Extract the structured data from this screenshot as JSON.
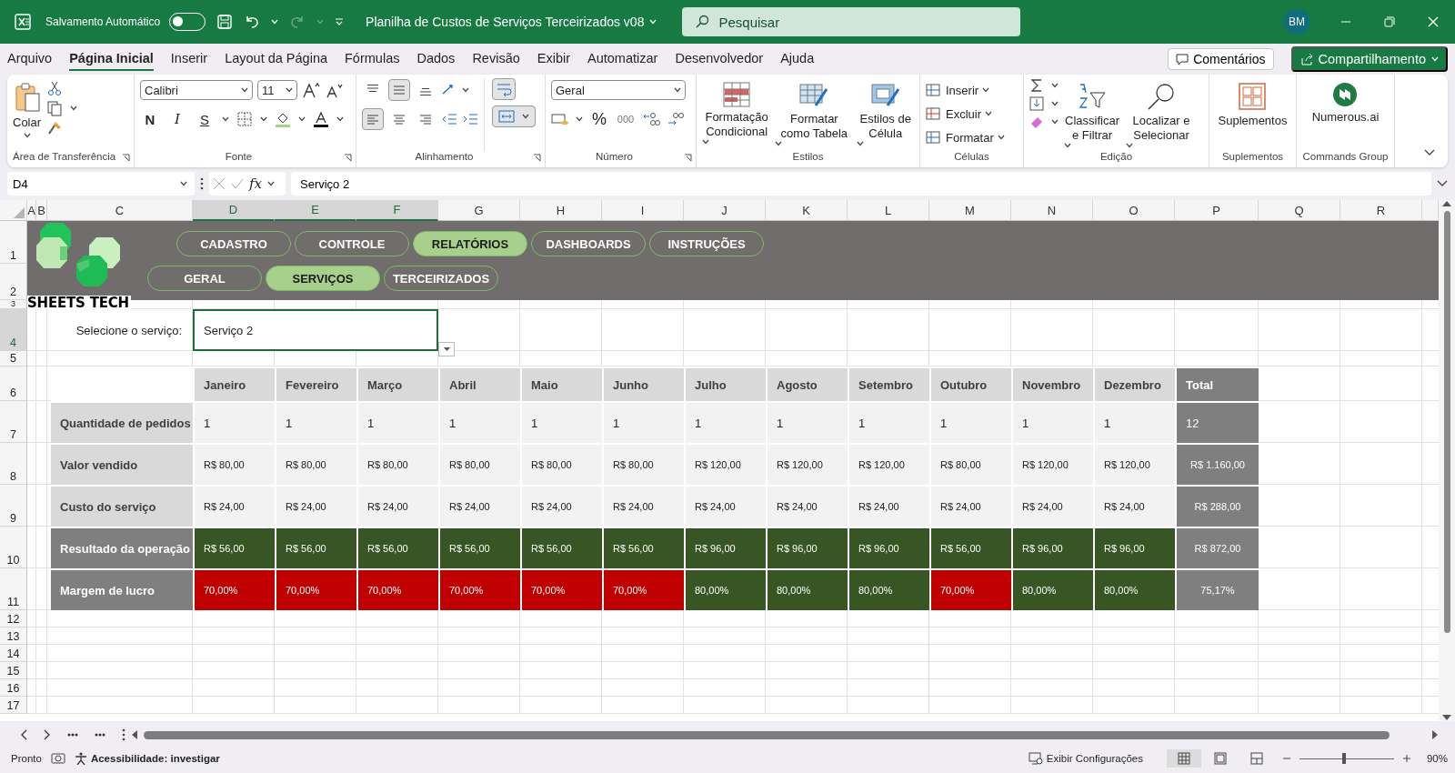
{
  "title_bar": {
    "autosave": {
      "label": "Salvamento Automático",
      "on": false
    },
    "document_title": "Planilha de Custos de Serviços Terceirizados v08",
    "search": {
      "placeholder": "Pesquisar"
    },
    "user_initials": "BM"
  },
  "menu_tabs": [
    {
      "label": "Arquivo",
      "selected": false
    },
    {
      "label": "Página Inicial",
      "selected": true
    },
    {
      "label": "Inserir",
      "selected": false
    },
    {
      "label": "Layout da Página",
      "selected": false
    },
    {
      "label": "Fórmulas",
      "selected": false
    },
    {
      "label": "Dados",
      "selected": false
    },
    {
      "label": "Revisão",
      "selected": false
    },
    {
      "label": "Exibir",
      "selected": false
    },
    {
      "label": "Automatizar",
      "selected": false
    },
    {
      "label": "Desenvolvedor",
      "selected": false
    },
    {
      "label": "Ajuda",
      "selected": false
    }
  ],
  "comments_button": "Comentários",
  "share_button": "Compartilhamento",
  "ribbon": {
    "clipboard": {
      "paste": "Colar",
      "label": "Área de Transferência"
    },
    "font": {
      "family": "Calibri",
      "size": "11",
      "bold": "N",
      "italic": "I",
      "underline": "S",
      "label": "Fonte"
    },
    "alignment": {
      "vertical": [
        {
          "selected": false
        },
        {
          "selected": true
        },
        {
          "selected": false
        }
      ],
      "horizontal": [
        {
          "selected": true
        },
        {
          "selected": false
        },
        {
          "selected": false
        }
      ],
      "label": "Alinhamento"
    },
    "number": {
      "format": "Geral",
      "percent": "%",
      "thousands": "000",
      "label": "Número"
    },
    "styles": {
      "buttons": [
        "Formatação Condicional",
        "Formatar como Tabela",
        "Estilos de Célula"
      ],
      "label": "Estilos"
    },
    "cells": {
      "buttons": [
        "Inserir",
        "Excluir",
        "Formatar"
      ],
      "label": "Células"
    },
    "editing": {
      "buttons": [
        "Classificar e Filtrar",
        "Localizar e Selecionar"
      ],
      "label": "Edição"
    },
    "addins": {
      "button": "Suplementos",
      "label": "Suplementos"
    },
    "commands": {
      "button": "Numerous.ai",
      "label": "Commands Group"
    }
  },
  "formula_bar": {
    "name_box": "D4",
    "fx": "fx",
    "value": "Serviço 2"
  },
  "columns": [
    {
      "label": "A",
      "selected": false
    },
    {
      "label": "B",
      "selected": false
    },
    {
      "label": "C",
      "selected": false
    },
    {
      "label": "D",
      "selected": true
    },
    {
      "label": "E",
      "selected": true
    },
    {
      "label": "F",
      "selected": true
    },
    {
      "label": "G",
      "selected": false
    },
    {
      "label": "H",
      "selected": false
    },
    {
      "label": "I",
      "selected": false
    },
    {
      "label": "J",
      "selected": false
    },
    {
      "label": "K",
      "selected": false
    },
    {
      "label": "L",
      "selected": false
    },
    {
      "label": "M",
      "selected": false
    },
    {
      "label": "N",
      "selected": false
    },
    {
      "label": "O",
      "selected": false
    },
    {
      "label": "P",
      "selected": false
    },
    {
      "label": "Q",
      "selected": false
    },
    {
      "label": "R",
      "selected": false
    }
  ],
  "rows": [
    {
      "label": "1",
      "selected": false
    },
    {
      "label": "2",
      "selected": false
    },
    {
      "label": "3",
      "selected": false
    },
    {
      "label": "4",
      "selected": true
    },
    {
      "label": "5",
      "selected": false
    },
    {
      "label": "6",
      "selected": false
    },
    {
      "label": "7",
      "selected": false
    },
    {
      "label": "8",
      "selected": false
    },
    {
      "label": "9",
      "selected": false
    },
    {
      "label": "10",
      "selected": false
    },
    {
      "label": "11",
      "selected": false
    },
    {
      "label": "12",
      "selected": false
    },
    {
      "label": "13",
      "selected": false
    },
    {
      "label": "14",
      "selected": false
    },
    {
      "label": "15",
      "selected": false
    },
    {
      "label": "16",
      "selected": false
    },
    {
      "label": "17",
      "selected": false
    }
  ],
  "sheet": {
    "logo_text": "SHEETS TECH",
    "nav_main": [
      {
        "label": "CADASTRO",
        "selected": false
      },
      {
        "label": "CONTROLE",
        "selected": false
      },
      {
        "label": "RELATÓRIOS",
        "selected": true
      },
      {
        "label": "DASHBOARDS",
        "selected": false
      },
      {
        "label": "INSTRUÇÕES",
        "selected": false
      }
    ],
    "nav_sub": [
      {
        "label": "GERAL",
        "selected": false
      },
      {
        "label": "SERVIÇOS",
        "selected": true
      },
      {
        "label": "TERCEIRIZADOS",
        "selected": false
      }
    ],
    "selector": {
      "label": "Selecione o serviço:",
      "value": "Serviço 2"
    },
    "table": {
      "columns": [
        "Janeiro",
        "Fevereiro",
        "Março",
        "Abril",
        "Maio",
        "Junho",
        "Julho",
        "Agosto",
        "Setembro",
        "Outubro",
        "Novembro",
        "Dezembro",
        "Total"
      ],
      "rows": [
        {
          "label": "Quantidade de pedidos",
          "kind": "count",
          "cells": [
            "1",
            "1",
            "1",
            "1",
            "1",
            "1",
            "1",
            "1",
            "1",
            "1",
            "1",
            "1"
          ],
          "total": "12"
        },
        {
          "label": "Valor vendido",
          "kind": "money",
          "cells": [
            "R$ 80,00",
            "R$ 80,00",
            "R$ 80,00",
            "R$ 80,00",
            "R$ 80,00",
            "R$ 80,00",
            "R$ 120,00",
            "R$ 120,00",
            "R$ 120,00",
            "R$ 80,00",
            "R$ 120,00",
            "R$ 120,00"
          ],
          "total": "R$ 1.160,00"
        },
        {
          "label": "Custo do serviço",
          "kind": "money",
          "cells": [
            "R$ 24,00",
            "R$ 24,00",
            "R$ 24,00",
            "R$ 24,00",
            "R$ 24,00",
            "R$ 24,00",
            "R$ 24,00",
            "R$ 24,00",
            "R$ 24,00",
            "R$ 24,00",
            "R$ 24,00",
            "R$ 24,00"
          ],
          "total": "R$ 288,00"
        },
        {
          "label": "Resultado da operação",
          "kind": "result",
          "cells": [
            "R$ 56,00",
            "R$ 56,00",
            "R$ 56,00",
            "R$ 56,00",
            "R$ 56,00",
            "R$ 56,00",
            "R$ 96,00",
            "R$ 96,00",
            "R$ 96,00",
            "R$ 56,00",
            "R$ 96,00",
            "R$ 96,00"
          ],
          "total": "R$ 872,00"
        },
        {
          "label": "Margem de lucro",
          "kind": "margin",
          "cells": [
            {
              "value": "70,00%",
              "color": "#c00000"
            },
            {
              "value": "70,00%",
              "color": "#c00000"
            },
            {
              "value": "70,00%",
              "color": "#c00000"
            },
            {
              "value": "70,00%",
              "color": "#c00000"
            },
            {
              "value": "70,00%",
              "color": "#c00000"
            },
            {
              "value": "70,00%",
              "color": "#c00000"
            },
            {
              "value": "80,00%",
              "color": "#375623"
            },
            {
              "value": "80,00%",
              "color": "#375623"
            },
            {
              "value": "80,00%",
              "color": "#375623"
            },
            {
              "value": "70,00%",
              "color": "#c00000"
            },
            {
              "value": "80,00%",
              "color": "#375623"
            },
            {
              "value": "80,00%",
              "color": "#375623"
            }
          ],
          "total": "75,17%"
        }
      ]
    }
  },
  "status_bar": {
    "state": "Pronto",
    "accessibility": "Acessibilidade: investigar",
    "display_settings": "Exibir Configurações",
    "views": [
      {
        "selected": true
      },
      {
        "selected": false
      },
      {
        "selected": false
      }
    ],
    "zoom": {
      "level": 0.47,
      "reading": "90%"
    }
  }
}
